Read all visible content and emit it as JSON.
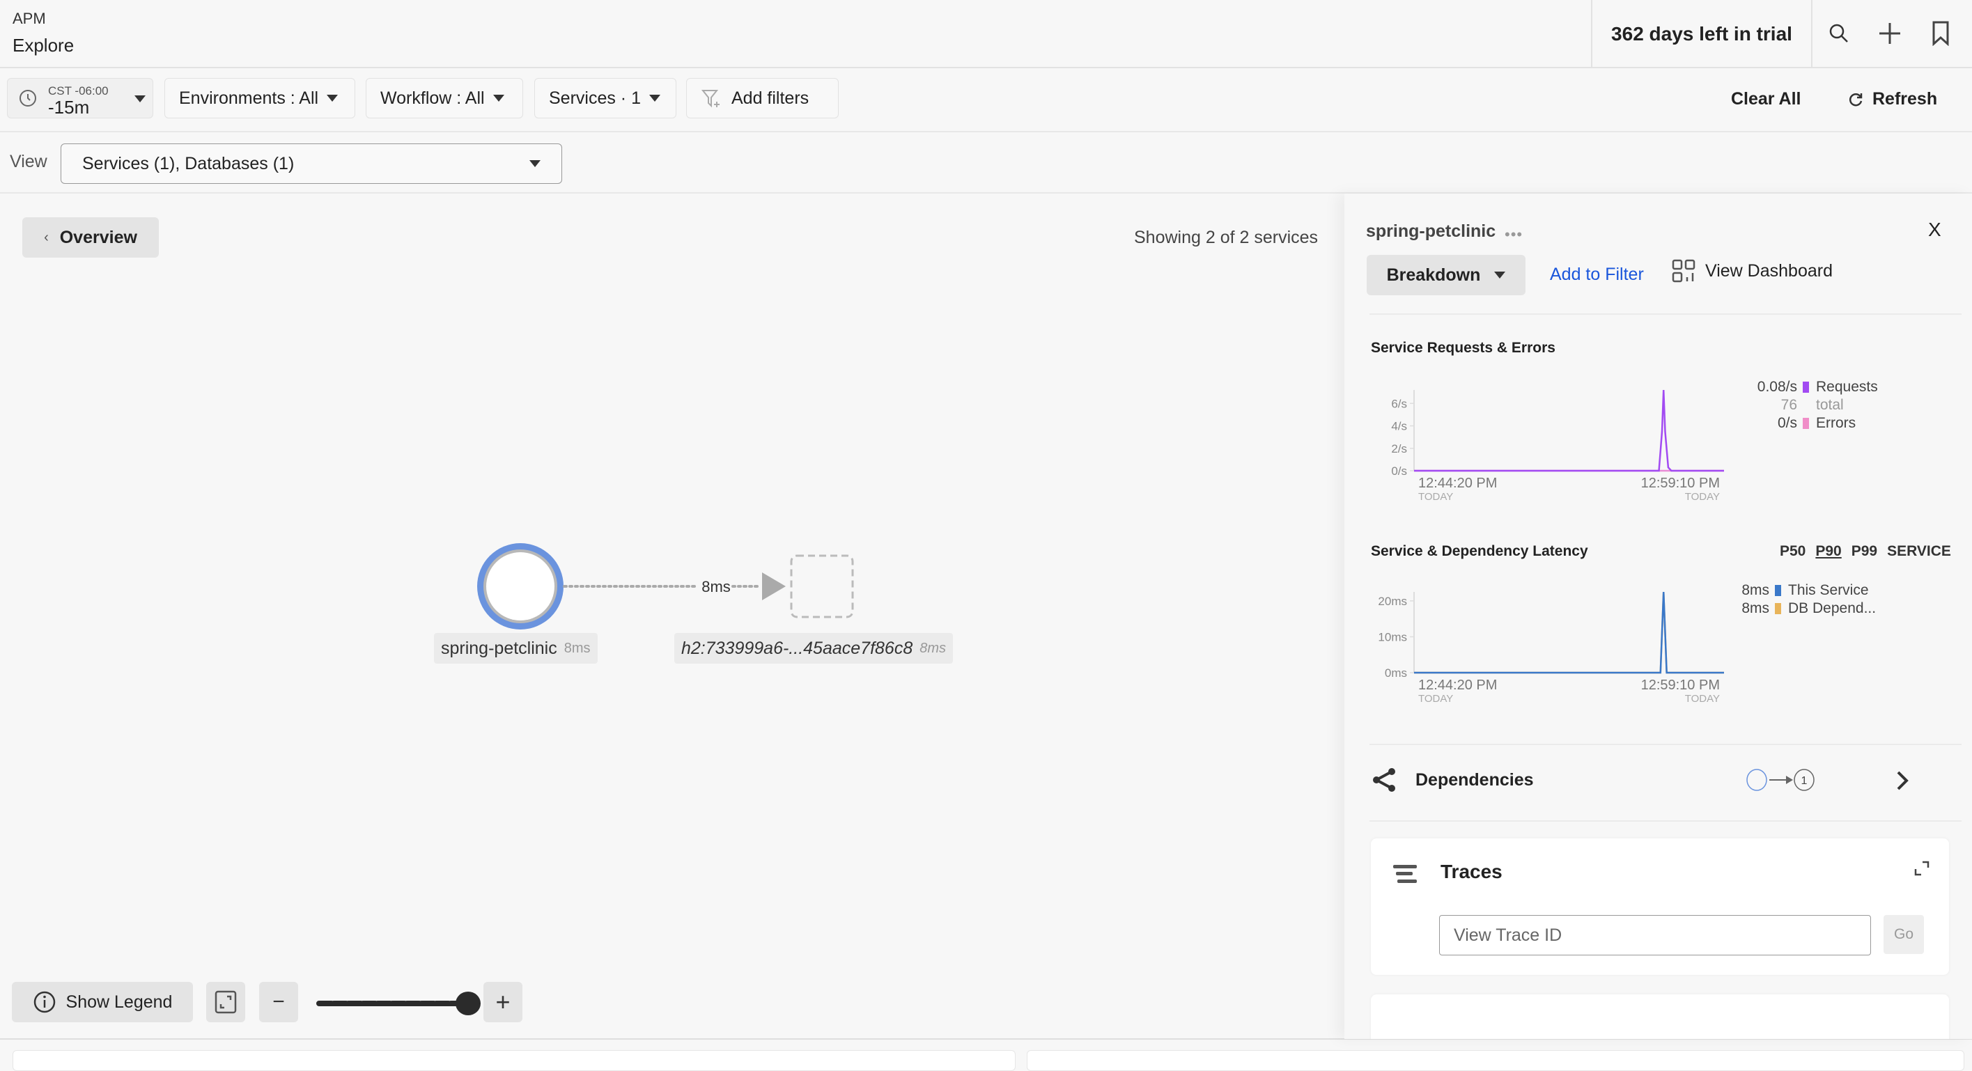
{
  "header": {
    "section": "APM",
    "page": "Explore",
    "trial": "362 days left in trial",
    "icons": [
      "search-icon",
      "plus-icon",
      "bookmark-icon"
    ]
  },
  "filters": {
    "time": {
      "timezone": "CST -06:00",
      "range": "-15m"
    },
    "environments": "Environments : All",
    "workflow": "Workflow : All",
    "services": "Services · 1",
    "add_filters": "Add filters",
    "clear_all": "Clear All",
    "refresh": "Refresh"
  },
  "view": {
    "label": "View",
    "selected": "Services (1), Databases (1)"
  },
  "map": {
    "overview_label": "Overview",
    "showing": "Showing 2 of 2 services",
    "nodes": [
      {
        "name": "spring-petclinic",
        "latency": "8ms",
        "type": "service"
      },
      {
        "name": "h2:733999a6-...45aace7f86c8",
        "latency": "8ms",
        "type": "database"
      }
    ],
    "edge_label": "8ms",
    "controls": {
      "show_legend": "Show Legend",
      "zoom_minus": "−",
      "zoom_plus": "+",
      "zoom_level_fraction": 1.0
    }
  },
  "panel": {
    "service": "spring-petclinic",
    "more": "•••",
    "close": "X",
    "breakdown": "Breakdown",
    "add_to_filter": "Add to Filter",
    "view_dashboard": "View Dashboard",
    "requests_chart": {
      "title": "Service Requests & Errors",
      "legend": [
        {
          "value": "0.08/s",
          "label": "Requests",
          "color": "#a24bf2"
        },
        {
          "value": "76",
          "label": "total",
          "sub": true
        },
        {
          "value": "0/s",
          "label": "Errors",
          "color": "#f08ec8"
        }
      ]
    },
    "latency_chart": {
      "title": "Service & Dependency Latency",
      "tabs": [
        "P50",
        "P90",
        "P99",
        "SERVICE"
      ],
      "selected_tab": "P90",
      "legend": [
        {
          "value": "8ms",
          "label": "This Service",
          "color": "#3a78c9"
        },
        {
          "value": "8ms",
          "label": "DB Depend...",
          "color": "#e8b45a"
        }
      ]
    },
    "dependencies": {
      "label": "Dependencies",
      "count": "1"
    },
    "traces": {
      "title": "Traces",
      "input_placeholder": "View Trace ID",
      "go": "Go"
    }
  },
  "chart_data": [
    {
      "type": "line",
      "title": "Service Requests & Errors",
      "x_ticks": [
        "12:44:20 PM",
        "12:59:10 PM"
      ],
      "x_tick_sublabels": [
        "TODAY",
        "TODAY"
      ],
      "y_ticks": [
        "0/s",
        "2/s",
        "4/s",
        "6/s"
      ],
      "ylim": [
        0,
        7.2
      ],
      "x_range_fraction": [
        0,
        1
      ],
      "series": [
        {
          "name": "Requests",
          "color": "#a24bf2",
          "x": [
            0,
            0.79,
            0.8,
            0.805,
            0.81,
            0.82,
            0.83,
            1.0
          ],
          "values": [
            0,
            0,
            3.5,
            7.2,
            3.5,
            0.3,
            0,
            0
          ]
        },
        {
          "name": "Errors",
          "color": "#e98bd6",
          "x": [
            0,
            1.0
          ],
          "values": [
            0,
            0
          ]
        }
      ]
    },
    {
      "type": "line",
      "title": "Service & Dependency Latency",
      "x_ticks": [
        "12:44:20 PM",
        "12:59:10 PM"
      ],
      "x_tick_sublabels": [
        "TODAY",
        "TODAY"
      ],
      "y_ticks": [
        "0ms",
        "10ms",
        "20ms"
      ],
      "ylim": [
        0,
        22.5
      ],
      "x_range_fraction": [
        0,
        1
      ],
      "series": [
        {
          "name": "This Service",
          "color": "#3a78c9",
          "x": [
            0,
            0.795,
            0.805,
            0.815,
            1.0
          ],
          "values": [
            0,
            0,
            22.5,
            0,
            0
          ]
        },
        {
          "name": "DB Dependency",
          "color": "#e0b56a",
          "x": [
            0,
            0.795,
            0.805,
            0.815,
            1.0
          ],
          "values": [
            0,
            0,
            22.5,
            0,
            0
          ]
        }
      ]
    }
  ]
}
